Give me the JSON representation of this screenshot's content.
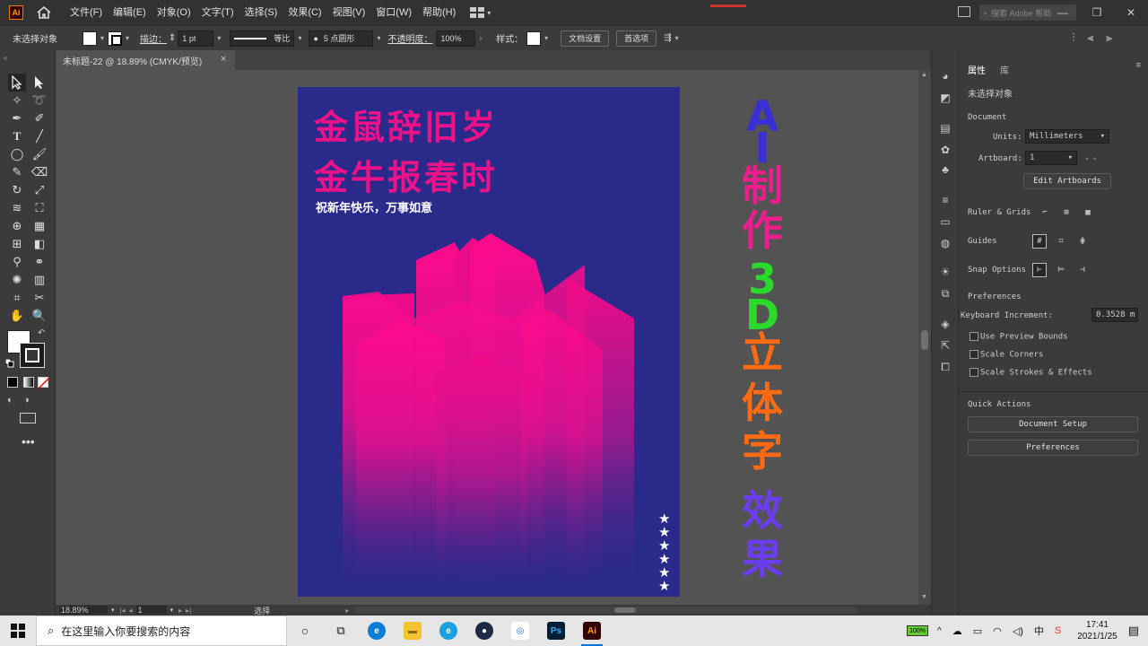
{
  "app": {
    "logo": "Ai",
    "menus": [
      "文件(F)",
      "编辑(E)",
      "对象(O)",
      "文字(T)",
      "选择(S)",
      "效果(C)",
      "视图(V)",
      "窗口(W)",
      "帮助(H)"
    ],
    "search_placeholder": "搜索 Adobe 帮助"
  },
  "control_bar": {
    "selection_label": "未选择对象",
    "stroke_label": "描边：",
    "stroke_value": "1 pt",
    "stroke_profile": "等比",
    "brush_value": "5 点圆形",
    "opacity_label": "不透明度：",
    "opacity_value": "100%",
    "style_label": "样式：",
    "doc_setup_button": "文档设置",
    "preferences_button": "首选项"
  },
  "document_tab": {
    "title": "未标题-22 @ 18.89% (CMYK/预览)",
    "close": "×"
  },
  "artboard": {
    "line1": "金鼠辞旧岁",
    "line2": "金牛报春时",
    "subtitle": "祝新年快乐，万事如意",
    "stars": [
      "★",
      "★",
      "★",
      "★",
      "★",
      "★"
    ],
    "colors": {
      "background": "#2a2a8a",
      "title": "#ec128a",
      "shape_top": "#ff0a8c"
    }
  },
  "overlay_text": {
    "chars": [
      {
        "text": "A",
        "color": "#3a2fd6"
      },
      {
        "text": "I",
        "color": "#3a2fd6"
      },
      {
        "text": "制",
        "color": "#ea1e8c"
      },
      {
        "text": "作",
        "color": "#ea1e8c"
      },
      {
        "text": "3",
        "color": "#2bd92b"
      },
      {
        "text": "D",
        "color": "#2bd92b"
      },
      {
        "text": "立",
        "color": "#ff6a13"
      },
      {
        "text": "体",
        "color": "#ff6a13"
      },
      {
        "text": "字",
        "color": "#ff6a13"
      },
      {
        "text": "效",
        "color": "#6a3df0"
      },
      {
        "text": "果",
        "color": "#6a3df0"
      }
    ]
  },
  "status_bar": {
    "zoom": "18.89%",
    "artboard_nav": "1",
    "tool_status": "选择"
  },
  "properties": {
    "tab_properties": "属性",
    "tab_library": "库",
    "no_selection": "未选择对象",
    "document_header": "Document",
    "units_label": "Units:",
    "units_value": "Millimeters",
    "artboard_label": "Artboard:",
    "artboard_value": "1",
    "edit_artboards_button": "Edit Artboards",
    "ruler_grids_label": "Ruler & Grids",
    "guides_label": "Guides",
    "snap_options_label": "Snap Options",
    "preferences_header": "Preferences",
    "keyboard_increment_label": "Keyboard Increment:",
    "keyboard_increment_value": "0.3528 m",
    "use_preview_bounds": "Use Preview Bounds",
    "scale_corners": "Scale Corners",
    "scale_strokes": "Scale Strokes & Effects",
    "quick_actions_header": "Quick Actions",
    "document_setup_button": "Document Setup",
    "preferences_button": "Preferences"
  },
  "taskbar": {
    "search_placeholder": "在这里输入你要搜索的内容",
    "battery": "100%",
    "time": "17:41",
    "date": "2021/1/25",
    "apps": [
      {
        "name": "edge",
        "label": "e",
        "bg": "#0a7cd6",
        "fg": "#ffffff"
      },
      {
        "name": "explorer",
        "label": "▬",
        "bg": "#f4c430",
        "fg": "#8a6d00"
      },
      {
        "name": "browser",
        "label": "e",
        "bg": "#1ba1e2",
        "fg": "#ffffff"
      },
      {
        "name": "cinema4d",
        "label": "●",
        "bg": "#1d2a44",
        "fg": "#ffffff"
      },
      {
        "name": "app-cloud",
        "label": "◎",
        "bg": "#ffffff",
        "fg": "#2a74d6"
      },
      {
        "name": "photoshop",
        "label": "Ps",
        "bg": "#001e36",
        "fg": "#31a8ff"
      },
      {
        "name": "illustrator",
        "label": "Ai",
        "bg": "#330000",
        "fg": "#ff9a00"
      }
    ]
  }
}
